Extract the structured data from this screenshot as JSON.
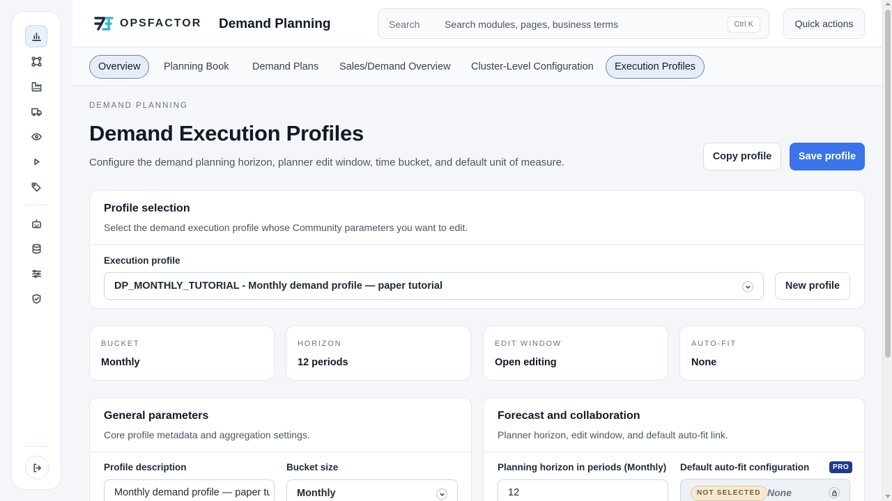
{
  "brand": {
    "name": "OPSFACTOR",
    "accent": "#3b73e8"
  },
  "header": {
    "app_title": "Demand Planning",
    "search_label": "Search",
    "search_placeholder": "Search modules, pages, business terms",
    "search_shortcut": "Ctrl K",
    "quick_actions": "Quick actions"
  },
  "rail": {
    "items": [
      {
        "icon": "bar-chart-icon",
        "active": true
      },
      {
        "icon": "network-icon"
      },
      {
        "icon": "factory-icon"
      },
      {
        "icon": "truck-icon"
      },
      {
        "icon": "eye-icon"
      },
      {
        "icon": "play-icon"
      },
      {
        "icon": "tag-icon"
      },
      {
        "icon": "robot-icon"
      },
      {
        "icon": "database-icon"
      },
      {
        "icon": "sliders-icon"
      },
      {
        "icon": "shield-check-icon"
      }
    ],
    "logout_icon": "logout-icon"
  },
  "tabs": [
    {
      "label": "Overview",
      "active": true
    },
    {
      "label": "Planning Book"
    },
    {
      "label": "Demand Plans"
    },
    {
      "label": "Sales/Demand Overview"
    },
    {
      "label": "Cluster-Level Configuration"
    },
    {
      "label": "Execution Profiles",
      "active": true
    }
  ],
  "page": {
    "eyebrow": "DEMAND PLANNING",
    "title": "Demand Execution Profiles",
    "subtitle": "Configure the demand planning horizon, planner edit window, time bucket, and default unit of measure.",
    "copy_button": "Copy profile",
    "save_button": "Save profile"
  },
  "profile_selection": {
    "title": "Profile selection",
    "subtitle": "Select the demand execution profile whose Community parameters you want to edit.",
    "field_label": "Execution profile",
    "selected": "DP_MONTHLY_TUTORIAL - Monthly demand profile — paper tutorial",
    "new_button": "New profile"
  },
  "stats": [
    {
      "label": "BUCKET",
      "value": "Monthly"
    },
    {
      "label": "HORIZON",
      "value": "12 periods"
    },
    {
      "label": "EDIT WINDOW",
      "value": "Open editing"
    },
    {
      "label": "AUTO-FIT",
      "value": "None"
    }
  ],
  "general": {
    "title": "General parameters",
    "subtitle": "Core profile metadata and aggregation settings.",
    "description_label": "Profile description",
    "description_value": "Monthly demand profile — paper tutorial",
    "bucket_label": "Bucket size",
    "bucket_value": "Monthly"
  },
  "forecast": {
    "title": "Forecast and collaboration",
    "subtitle": "Planner horizon, edit window, and default auto-fit link.",
    "horizon_label": "Planning horizon in periods (Monthly)",
    "horizon_value": "12",
    "autofit_label": "Default auto-fit configuration",
    "pro_badge": "PRO",
    "status_badge": "NOT SELECTED",
    "autofit_value": "None"
  }
}
